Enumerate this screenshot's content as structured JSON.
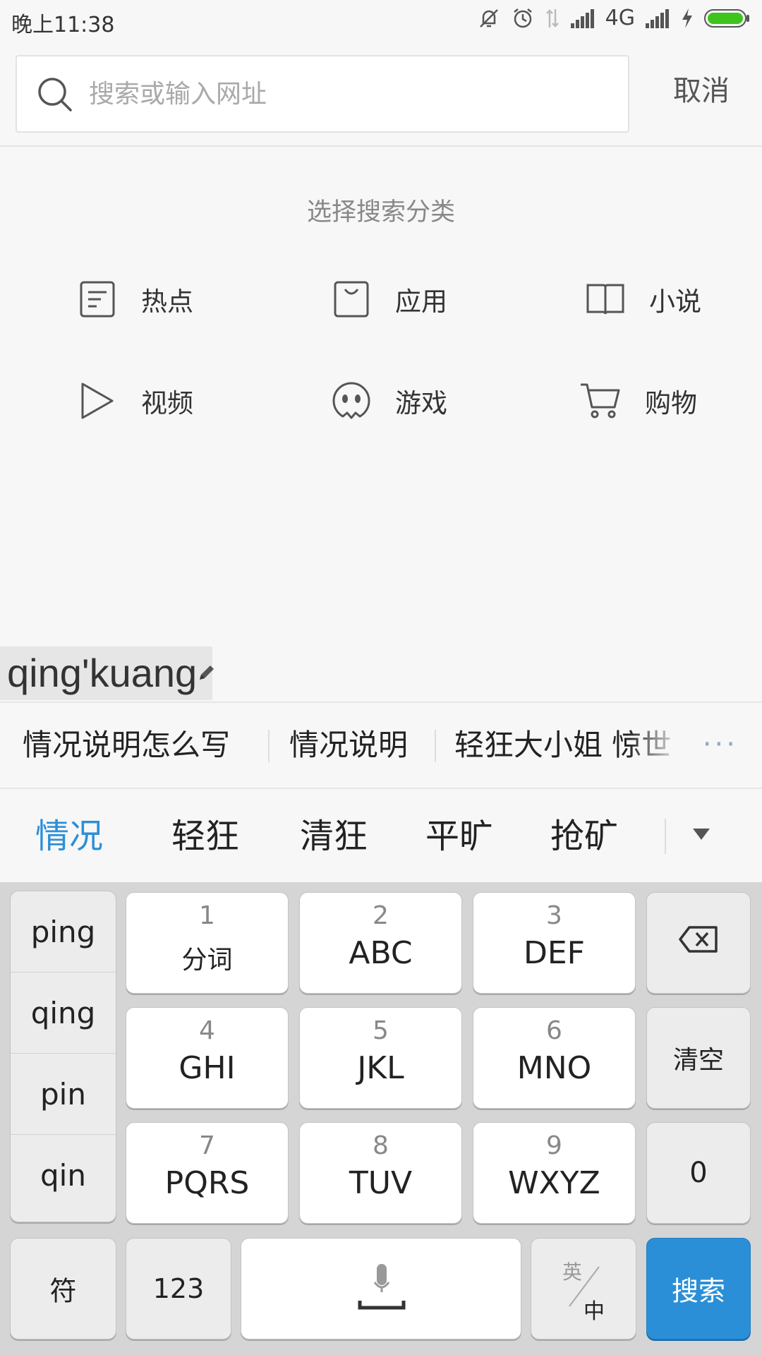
{
  "status_bar": {
    "time": "晚上11:38",
    "network": "4G",
    "icons": [
      "mute-icon",
      "alarm-icon",
      "data-transfer-icon",
      "signal-icon",
      "signal-icon",
      "charging-icon",
      "battery-icon"
    ],
    "battery_color": "#3ec41d"
  },
  "search": {
    "placeholder": "搜索或输入网址",
    "value": "",
    "cancel_label": "取消"
  },
  "categories": {
    "title": "选择搜索分类",
    "items": [
      {
        "label": "热点",
        "icon": "news-icon"
      },
      {
        "label": "应用",
        "icon": "shopping-bag-icon"
      },
      {
        "label": "小说",
        "icon": "book-icon"
      },
      {
        "label": "视频",
        "icon": "play-icon"
      },
      {
        "label": "游戏",
        "icon": "game-face-icon"
      },
      {
        "label": "购物",
        "icon": "cart-icon"
      }
    ]
  },
  "ime": {
    "composition": "qing'kuang",
    "suggestions": [
      "情况说明怎么写",
      "情况说明",
      "轻狂大小姐 惊世"
    ],
    "more_label": "···",
    "candidates": [
      "情况",
      "轻狂",
      "清狂",
      "平旷",
      "抢矿"
    ],
    "active_candidate_color": "#2d8fd7",
    "pinyin_options": [
      "ping",
      "qing",
      "pin",
      "qin"
    ],
    "keys": [
      {
        "num": "1",
        "letters": "分词"
      },
      {
        "num": "2",
        "letters": "ABC"
      },
      {
        "num": "3",
        "letters": "DEF"
      },
      {
        "num": "4",
        "letters": "GHI"
      },
      {
        "num": "5",
        "letters": "JKL"
      },
      {
        "num": "6",
        "letters": "MNO"
      },
      {
        "num": "7",
        "letters": "PQRS"
      },
      {
        "num": "8",
        "letters": "TUV"
      },
      {
        "num": "9",
        "letters": "WXYZ"
      }
    ],
    "clear_label": "清空",
    "zero_label": "0",
    "symbol_label": "符",
    "num_label": "123",
    "lang_top": "英",
    "lang_bottom": "中",
    "search_label": "搜索",
    "search_color": "#2b8fd7"
  }
}
